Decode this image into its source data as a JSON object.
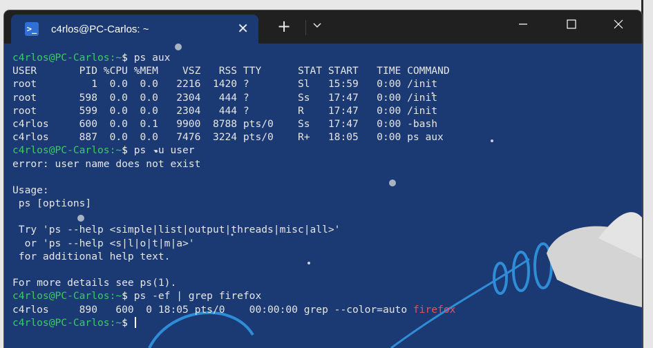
{
  "window": {
    "tab_title": "c4rlos@PC-Carlos: ~",
    "tab_icon": "powershell-icon",
    "new_tab_label": "+",
    "close_tab_label": "✕",
    "colors": {
      "background": "#1b3a73",
      "titlebar": "#202020",
      "prompt": "#3fc86a",
      "highlight": "#e8505b"
    }
  },
  "terminal": {
    "prompt": "c4rlos@PC-Carlos",
    "lines": [
      {
        "type": "prompt",
        "path": ":~",
        "cmd": "ps aux"
      },
      {
        "type": "out",
        "text": "USER       PID %CPU %MEM    VSZ   RSS TTY      STAT START   TIME COMMAND"
      },
      {
        "type": "out",
        "text": "root         1  0.0  0.0   2216  1420 ?        Sl   15:59   0:00 /init"
      },
      {
        "type": "out",
        "text": "root       598  0.0  0.0   2304   444 ?        Ss   17:47   0:00 /init"
      },
      {
        "type": "out",
        "text": "root       599  0.0  0.0   2304   444 ?        R    17:47   0:00 /init"
      },
      {
        "type": "out",
        "text": "c4rlos     600  0.0  0.1   9900  8788 pts/0    Ss   17:47   0:00 -bash"
      },
      {
        "type": "out",
        "text": "c4rlos     887  0.0  0.0   7476  3224 pts/0    R+   18:05   0:00 ps aux"
      },
      {
        "type": "prompt",
        "path": ":~",
        "cmd": "ps -u user"
      },
      {
        "type": "out",
        "text": "error: user name does not exist"
      },
      {
        "type": "out",
        "text": ""
      },
      {
        "type": "out",
        "text": "Usage:"
      },
      {
        "type": "out",
        "text": " ps [options]"
      },
      {
        "type": "out",
        "text": ""
      },
      {
        "type": "out",
        "text": " Try 'ps --help <simple|list|output|threads|misc|all>'"
      },
      {
        "type": "out",
        "text": "  or 'ps --help <s|l|o|t|m|a>'"
      },
      {
        "type": "out",
        "text": " for additional help text."
      },
      {
        "type": "out",
        "text": ""
      },
      {
        "type": "out",
        "text": "For more details see ps(1)."
      },
      {
        "type": "prompt",
        "path": ":~",
        "cmd": "ps -ef | grep firefox"
      },
      {
        "type": "grep",
        "before": "c4rlos     890   600  0 18:05 pts/0    00:00:00 grep --color=auto ",
        "match": "firefox"
      },
      {
        "type": "prompt",
        "path": ":~",
        "cmd": "",
        "cursor": true
      }
    ]
  }
}
